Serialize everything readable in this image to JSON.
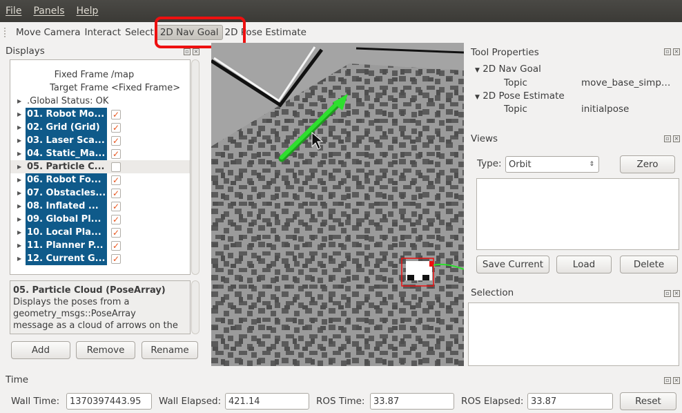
{
  "menu": {
    "file": "File",
    "panels": "Panels",
    "help": "Help"
  },
  "toolbar": {
    "move_camera": "Move Camera",
    "interact": "Interact",
    "select": "Select",
    "nav_goal": "2D Nav Goal",
    "pose_estimate": "2D Pose Estimate"
  },
  "displays": {
    "title": "Displays",
    "fixed_frame_label": "Fixed Frame",
    "fixed_frame_value": "/map",
    "target_frame_label": "Target Frame",
    "target_frame_value": "<Fixed Frame>",
    "global_status": ".Global Status: OK",
    "items": [
      {
        "label": "01. Robot Mo...",
        "checked": true
      },
      {
        "label": "02. Grid (Grid)",
        "checked": true
      },
      {
        "label": "03. Laser Sca...",
        "checked": true
      },
      {
        "label": "04. Static_Ma...",
        "checked": true
      },
      {
        "label": "05. Particle C...",
        "checked": false
      },
      {
        "label": "06. Robot Fo...",
        "checked": true
      },
      {
        "label": "07. Obstacles...",
        "checked": true
      },
      {
        "label": "08. Inflated ...",
        "checked": true
      },
      {
        "label": "09. Global Pl...",
        "checked": true
      },
      {
        "label": "10. Local Pla...",
        "checked": true
      },
      {
        "label": "11. Planner P...",
        "checked": true
      },
      {
        "label": "12. Current G...",
        "checked": true
      }
    ],
    "description_title": "05. Particle Cloud (PoseArray)",
    "description_lines": [
      "Displays the poses from a",
      "geometry_msgs::PoseArray",
      "message as a cloud of arrows on the"
    ],
    "add_button": "Add",
    "remove_button": "Remove",
    "rename_button": "Rename"
  },
  "tool_properties": {
    "title": "Tool Properties",
    "nav_goal": "2D Nav Goal",
    "nav_goal_topic_label": "Topic",
    "nav_goal_topic_value": "move_base_simp…",
    "pose_estimate": "2D Pose Estimate",
    "pose_estimate_topic_label": "Topic",
    "pose_estimate_topic_value": "initialpose"
  },
  "views": {
    "title": "Views",
    "type_label": "Type:",
    "type_value": "Orbit",
    "zero_button": "Zero",
    "save_current_button": "Save Current",
    "load_button": "Load",
    "delete_button": "Delete"
  },
  "selection": {
    "title": "Selection"
  },
  "time": {
    "title": "Time",
    "wall_time_label": "Wall Time:",
    "wall_time_value": "1370397443.95",
    "wall_elapsed_label": "Wall Elapsed:",
    "wall_elapsed_value": "421.14",
    "ros_time_label": "ROS Time:",
    "ros_time_value": "33.87",
    "ros_elapsed_label": "ROS Elapsed:",
    "ros_elapsed_value": "33.87",
    "reset_button": "Reset"
  },
  "colors": {
    "selection_blue": "#0f5a8a",
    "highlight_red": "#ee1010",
    "goal_arrow_green": "#22dd22",
    "checkbox_orange": "#e8541c"
  }
}
